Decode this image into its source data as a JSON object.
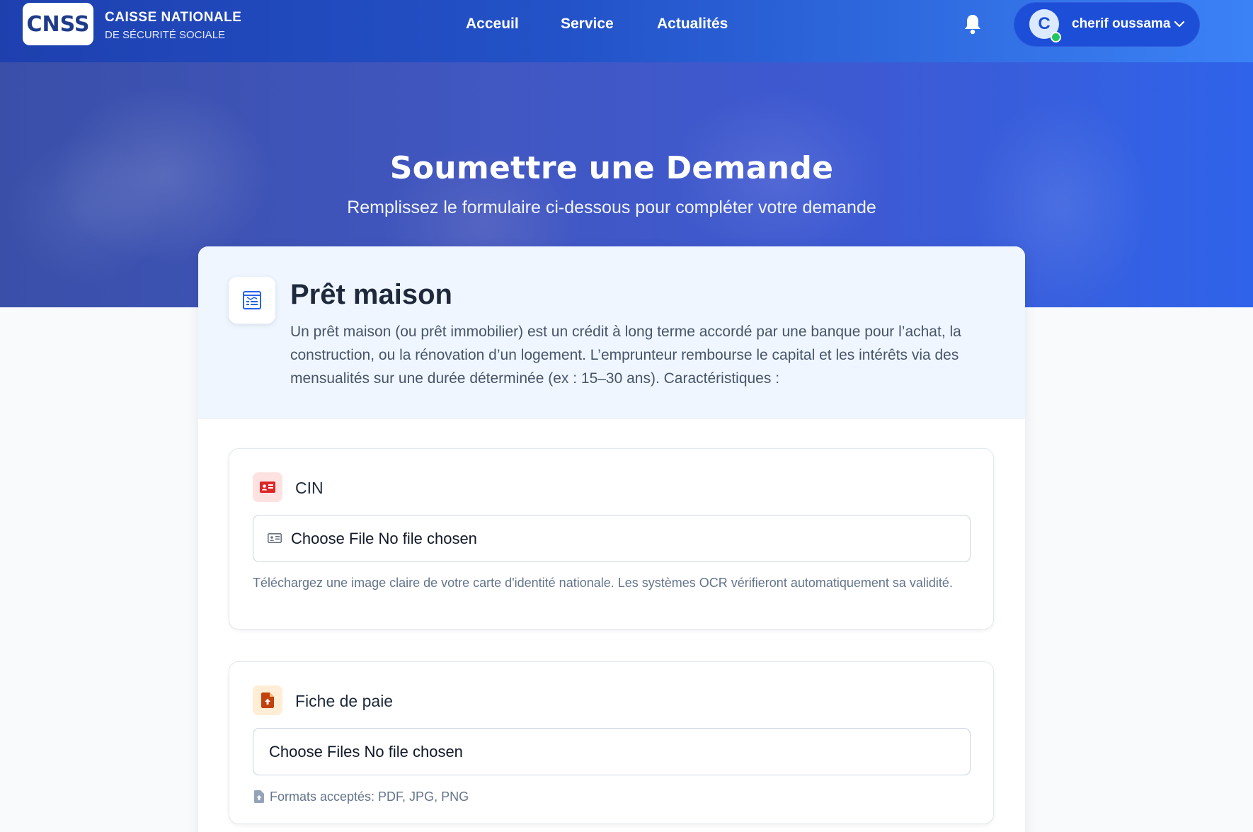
{
  "header": {
    "logo_text": "CNSS",
    "brand_line1": "CAISSE NATIONALE",
    "brand_line2": "DE SÉCURITÉ SOCIALE",
    "nav": [
      {
        "label": "Acceuil"
      },
      {
        "label": "Service"
      },
      {
        "label": "Actualités"
      }
    ],
    "user": {
      "avatar_initial": "C",
      "name": "cherif oussama",
      "status": "online"
    }
  },
  "hero": {
    "title": "Soumettre une Demande",
    "subtitle": "Remplissez le formulaire ci-dessous pour compléter votre demande"
  },
  "request": {
    "title": "Prêt maison",
    "description": "Un prêt maison (ou prêt immobilier) est un crédit à long terme accordé par une banque pour l’achat, la construction, ou la rénovation d’un logement. L’emprunteur rembourse le capital et les intérêts via des mensualités sur une durée déterminée (ex : 15–30 ans). Caractéristiques :",
    "icon": "form-icon"
  },
  "fields": [
    {
      "label": "CIN",
      "icon": "id-card-icon",
      "input_text": "Choose File No file chosen",
      "help": "Téléchargez une image claire de votre carte d'identité nationale. Les systèmes OCR vérifieront automatiquement sa validité."
    },
    {
      "label": "Fiche de paie",
      "icon": "file-upload-icon",
      "input_text": "Choose Files No file chosen",
      "help": "Formats acceptés: PDF, JPG, PNG"
    }
  ],
  "colors": {
    "primary": "#1d4ed8",
    "header_gradient_end": "#3b82f6",
    "cin_icon": "#dc2626",
    "payslip_icon": "#c2410c",
    "online": "#22c55e"
  }
}
